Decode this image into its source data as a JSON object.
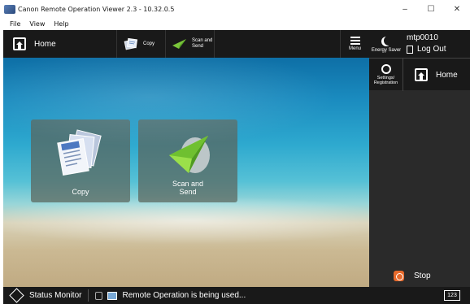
{
  "window": {
    "title": "Canon Remote Operation Viewer 2.3 - 10.32.0.5",
    "icon": "canon-app-icon",
    "controls": [
      "–",
      "☐",
      "✕"
    ]
  },
  "menubar": {
    "items": [
      "File",
      "View",
      "Help"
    ]
  },
  "topnav": {
    "home_label": "Home",
    "shortcuts": [
      {
        "label": "Copy",
        "icon": "copy-icon"
      },
      {
        "label": "Scan and\nSend",
        "icon": "scan-send-icon"
      }
    ],
    "menu_label": "Menu"
  },
  "main": {
    "tiles": [
      {
        "label": "Copy",
        "icon": "copy-icon"
      },
      {
        "label": "Scan and\nSend",
        "icon": "paper-plane-icon"
      }
    ]
  },
  "side": {
    "energy_saver": "Energy Saver",
    "user": "mtp0010",
    "logout": "Log Out",
    "settings": "Settings/\nRegistration",
    "home": "Home",
    "stop": "Stop"
  },
  "statusbar": {
    "status_monitor": "Status Monitor",
    "message": "Remote Operation is being used...",
    "counter": "123"
  },
  "colors": {
    "bar": "#191919",
    "stop": "#e86a2c",
    "tile": "#5a645a"
  }
}
